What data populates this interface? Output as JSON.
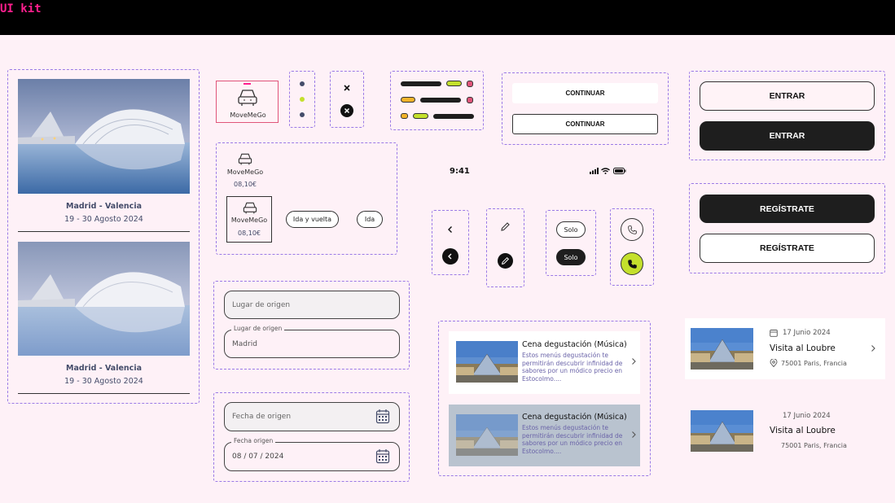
{
  "header": {
    "title": "UI kit"
  },
  "destinations": [
    {
      "title": "Madrid - Valencia",
      "dates": "19 - 30 Agosto 2024"
    },
    {
      "title": "Madrid - Valencia",
      "dates": "19 - 30 Agosto 2024"
    }
  ],
  "vehicle": {
    "brand": "MoveMeGo",
    "price": "08,10€"
  },
  "trip_options": {
    "round_trip": "Ida y vuelta",
    "one_way": "Ida"
  },
  "status_bar": {
    "time": "9:41"
  },
  "buttons": {
    "continue": "CONTINUAR",
    "enter": "ENTRAR",
    "register": "REGÍSTRATE",
    "solo": "Solo"
  },
  "inputs": {
    "origin_placeholder": "Lugar de origen",
    "origin_label": "Lugar de origen",
    "origin_value": "Madrid",
    "date_placeholder": "Fecha de origen",
    "date_label": "Fecha origen",
    "date_value": "08 / 07 / 2024"
  },
  "events": [
    {
      "title": "Cena degustación (Música)",
      "description": "Estos menús degustación te permitirán descubrir infinidad de sabores por un módico precio en Estocolmo...."
    },
    {
      "title": "Cena degustación (Música)",
      "description": "Estos menús degustación te permitirán descubrir infinidad de sabores por un módico precio en Estocolmo...."
    }
  ],
  "visits": [
    {
      "date": "17 Junio 2024",
      "title": "Visita al Loubre",
      "address": "75001 Paris, Francia"
    },
    {
      "date": "17 Junio 2024",
      "title": "Visita al Loubre",
      "address": "75001 Paris, Francia"
    }
  ],
  "colors": {
    "accent_pink": "#ff1f8e",
    "accent_lime": "#c4e02c",
    "accent_yellow": "#f2b32a",
    "dark": "#1e1e1e",
    "dash": "#9b7ae6"
  },
  "icons": [
    "car-icon",
    "close-icon",
    "chevron-left-icon",
    "pencil-icon",
    "phone-icon",
    "calendar-icon",
    "location-icon",
    "chevron-right-icon",
    "signal-icon",
    "wifi-icon",
    "battery-icon"
  ]
}
